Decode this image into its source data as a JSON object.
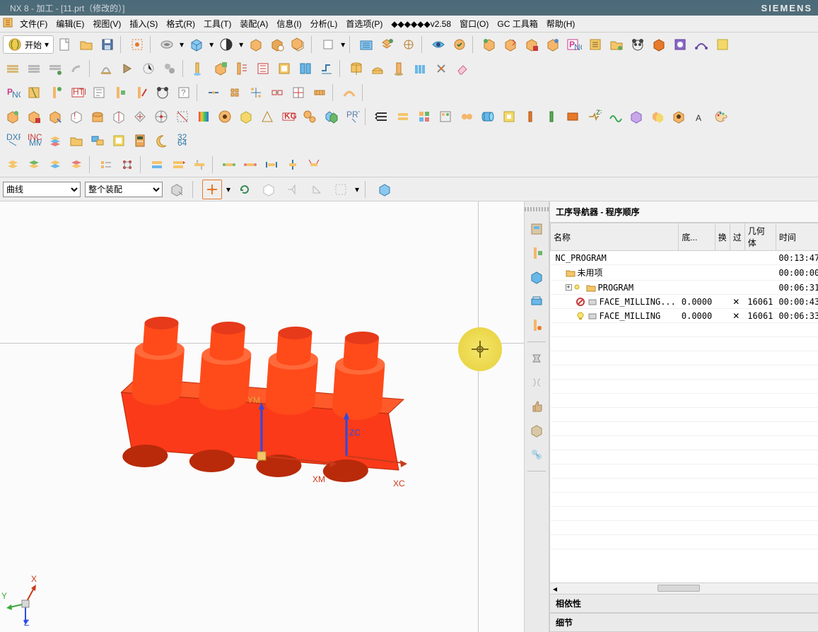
{
  "titlebar": {
    "app": "NX 8",
    "context": "加工",
    "doc": "[11.prt（修改的）]",
    "brand": "SIEMENS"
  },
  "menu": {
    "items": [
      "文件(F)",
      "编辑(E)",
      "视图(V)",
      "插入(S)",
      "格式(R)",
      "工具(T)",
      "装配(A)",
      "信息(I)",
      "分析(L)",
      "首选项(P)",
      "◆◆◆◆◆◆v2.58",
      "窗口(O)",
      "GC 工具箱",
      "帮助(H)"
    ]
  },
  "start_label": "开始",
  "selectors": {
    "curve": "曲线",
    "assembly": "整个装配"
  },
  "axis_labels": {
    "ym": "YM",
    "zc": "ZC",
    "xm": "XM",
    "xc": "XC",
    "yx": "X",
    "yy": "Y",
    "yz": "Z"
  },
  "navigator": {
    "title": "工序导航器 - 程序顺序",
    "columns": [
      "名称",
      "底...",
      "换",
      "过",
      "几何体",
      "时间"
    ],
    "rows": [
      {
        "indent": 0,
        "name": "NC_PROGRAM",
        "di": "",
        "huan": "",
        "guo": "",
        "geom": "",
        "time": "00:13:47",
        "icon": "none"
      },
      {
        "indent": 1,
        "name": "未用项",
        "di": "",
        "huan": "",
        "guo": "",
        "geom": "",
        "time": "00:00:00",
        "icon": "folder"
      },
      {
        "indent": 1,
        "name": "PROGRAM",
        "di": "",
        "huan": "",
        "guo": "",
        "geom": "",
        "time": "00:06:31",
        "icon": "folder-bulb",
        "expander": "+"
      },
      {
        "indent": 2,
        "name": "FACE_MILLING...",
        "di": "0.0000",
        "huan": "",
        "guo": "✕",
        "geom": "16061",
        "time": "00:00:43",
        "icon": "forbid"
      },
      {
        "indent": 2,
        "name": "FACE_MILLING",
        "di": "0.0000",
        "huan": "",
        "guo": "✕",
        "geom": "16061",
        "time": "00:06:33",
        "icon": "bulb"
      }
    ],
    "section_dep": "相依性",
    "section_detail": "细节"
  }
}
